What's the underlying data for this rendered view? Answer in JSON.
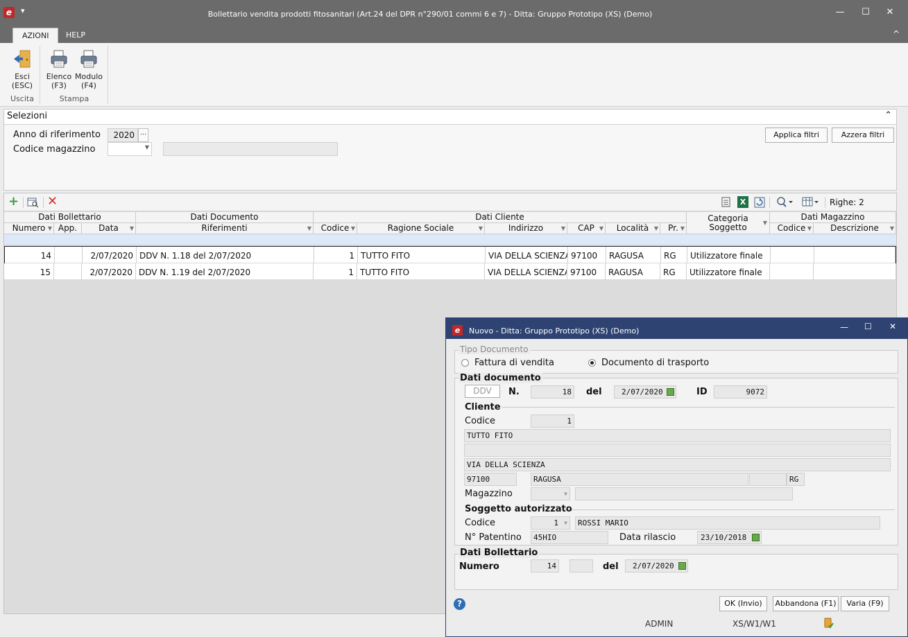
{
  "window": {
    "title": "Bollettario vendita prodotti fitosanitari (Art.24 del DPR n°290/01 commi 6 e 7) - Ditta: Gruppo Prototipo (XS)  (Demo)",
    "quick_access": "▾",
    "minimize": "—",
    "maximize": "☐",
    "close": "✕"
  },
  "ribbon": {
    "tabs": [
      {
        "label": "AZIONI"
      },
      {
        "label": "HELP"
      }
    ],
    "collapse": "^",
    "buttons": {
      "esci": {
        "line1": "Esci",
        "line2": "(ESC)"
      },
      "elenco": {
        "line1": "Elenco",
        "line2": "(F3)"
      },
      "modulo": {
        "line1": "Modulo",
        "line2": "(F4)"
      }
    },
    "groups": {
      "uscita": "Uscita",
      "stampa": "Stampa"
    }
  },
  "selezioni": {
    "title": "Selezioni",
    "anno_label": "Anno di riferimento",
    "anno_value": "2020",
    "magazzino_label": "Codice magazzino",
    "magazzino_value": "",
    "apply_button": "Applica filtri",
    "reset_button": "Azzera filtri"
  },
  "grid": {
    "righe_label": "Righe: 2",
    "bands": {
      "bollettario": "Dati Bollettario",
      "documento": "Dati Documento",
      "cliente": "Dati Cliente",
      "categoria": "Categoria Soggetto",
      "magazzino": "Dati Magazzino"
    },
    "columns": {
      "numero": "Numero",
      "app": "App.",
      "data": "Data",
      "riferimenti": "Riferimenti",
      "codice": "Codice",
      "ragione": "Ragione Sociale",
      "indirizzo": "Indirizzo",
      "cap": "CAP",
      "localita": "Località",
      "pr": "Pr.",
      "mag_codice": "Codice",
      "mag_descrizione": "Descrizione"
    },
    "rows": [
      {
        "numero": "14",
        "app": "",
        "data": "2/07/2020",
        "riferimenti": "DDV N. 1.18 del 2/07/2020",
        "codice": "1",
        "ragione": "TUTTO FITO",
        "indirizzo": "VIA DELLA SCIENZA",
        "cap": "97100",
        "localita": "RAGUSA",
        "pr": "RG",
        "categoria": "Utilizzatore finale",
        "mag_codice": "",
        "mag_descrizione": ""
      },
      {
        "numero": "15",
        "app": "",
        "data": "2/07/2020",
        "riferimenti": "DDV N. 1.19 del 2/07/2020",
        "codice": "1",
        "ragione": "TUTTO FITO",
        "indirizzo": "VIA DELLA SCIENZA",
        "cap": "97100",
        "localita": "RAGUSA",
        "pr": "RG",
        "categoria": "Utilizzatore finale",
        "mag_codice": "",
        "mag_descrizione": ""
      }
    ]
  },
  "dialog": {
    "title": "Nuovo - Ditta: Gruppo Prototipo (XS)  (Demo)",
    "tipo_documento": {
      "legend": "Tipo Documento",
      "option1": "Fattura di vendita",
      "option2": "Documento di trasporto",
      "selected": "Documento di trasporto"
    },
    "dati_documento": {
      "legend": "Dati documento",
      "tipo": "DDV",
      "n_label": "N.",
      "n_value": "18",
      "del_label": "del",
      "del_value": "2/07/2020",
      "id_label": "ID",
      "id_value": "9072"
    },
    "cliente": {
      "legend": "Cliente",
      "codice_label": "Codice",
      "codice_value": "1",
      "ragione": "TUTTO FITO",
      "ragione2": "",
      "indirizzo": "VIA DELLA SCIENZA",
      "cap": "97100",
      "localita": "RAGUSA",
      "extra": "",
      "pr": "RG",
      "magazzino_label": "Magazzino",
      "magazzino_value": "",
      "magazzino_desc": ""
    },
    "soggetto": {
      "legend": "Soggetto autorizzato",
      "codice_label": "Codice",
      "codice_value": "1",
      "nome": "ROSSI MARIO",
      "patentino_label": "N° Patentino",
      "patentino_value": "45HIO",
      "rilascio_label": "Data rilascio",
      "rilascio_value": "23/10/2018"
    },
    "bollettario": {
      "legend": "Dati Bollettario",
      "numero_label": "Numero",
      "numero_value": "14",
      "suffix": "",
      "del_label": "del",
      "del_value": "2/07/2020"
    },
    "buttons": {
      "ok": "OK (Invio)",
      "abbandona": "Abbandona (F1)",
      "varia": "Varia (F9)"
    },
    "status": {
      "user": "ADMIN",
      "info": "XS/W1/W1"
    },
    "help": "?"
  },
  "colors": {
    "title_bar": "#6b6b6b",
    "dialog_title": "#2f4373",
    "brand_red": "#c0282a"
  }
}
